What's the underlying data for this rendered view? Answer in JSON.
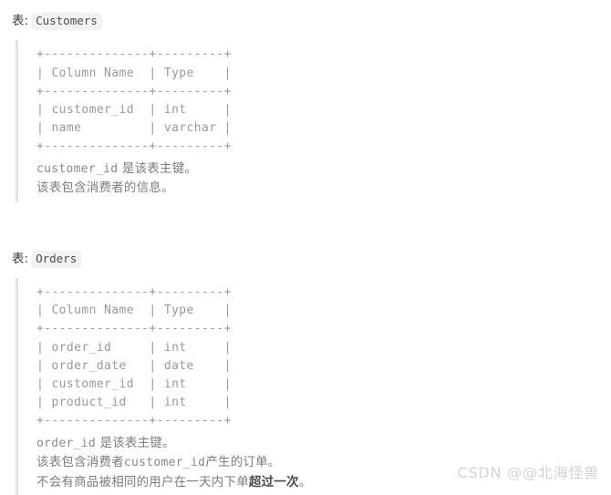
{
  "document": {
    "watermark": "CSDN @@北海怪兽"
  },
  "blocks": [
    {
      "label_prefix": "表:",
      "table_name": "Customers",
      "ascii": "+--------------+---------+\n| Column Name  | Type    |\n+--------------+---------+\n| customer_id  | int     |\n| name         | varchar |\n+--------------+---------+",
      "notes": [
        {
          "parts": [
            {
              "text": "customer_id",
              "style": "mono"
            },
            {
              "text": " 是该表主键。",
              "style": "normal"
            }
          ]
        },
        {
          "parts": [
            {
              "text": "该表包含消费者的信息。",
              "style": "normal"
            }
          ]
        }
      ]
    },
    {
      "label_prefix": "表:",
      "table_name": "Orders",
      "ascii": "+--------------+---------+\n| Column Name  | Type    |\n+--------------+---------+\n| order_id     | int     |\n| order_date   | date    |\n| customer_id  | int     |\n| product_id   | int     |\n+--------------+---------+",
      "notes": [
        {
          "parts": [
            {
              "text": "order_id",
              "style": "mono"
            },
            {
              "text": " 是该表主键。",
              "style": "normal"
            }
          ]
        },
        {
          "parts": [
            {
              "text": "该表包含消费者",
              "style": "normal"
            },
            {
              "text": "customer_id",
              "style": "mono"
            },
            {
              "text": "产生的订单。",
              "style": "normal"
            }
          ]
        },
        {
          "parts": [
            {
              "text": "不会有商品被相同的用户在一天内下单",
              "style": "normal"
            },
            {
              "text": "超过一次",
              "style": "bold"
            },
            {
              "text": "。",
              "style": "normal"
            }
          ]
        }
      ]
    }
  ],
  "table_schemas": [
    {
      "name": "Customers",
      "columns": [
        {
          "column_name": "customer_id",
          "type": "int"
        },
        {
          "column_name": "name",
          "type": "varchar"
        }
      ],
      "header": [
        "Column Name",
        "Type"
      ],
      "primary_key": "customer_id"
    },
    {
      "name": "Orders",
      "columns": [
        {
          "column_name": "order_id",
          "type": "int"
        },
        {
          "column_name": "order_date",
          "type": "date"
        },
        {
          "column_name": "customer_id",
          "type": "int"
        },
        {
          "column_name": "product_id",
          "type": "int"
        }
      ],
      "header": [
        "Column Name",
        "Type"
      ],
      "primary_key": "order_id"
    }
  ]
}
